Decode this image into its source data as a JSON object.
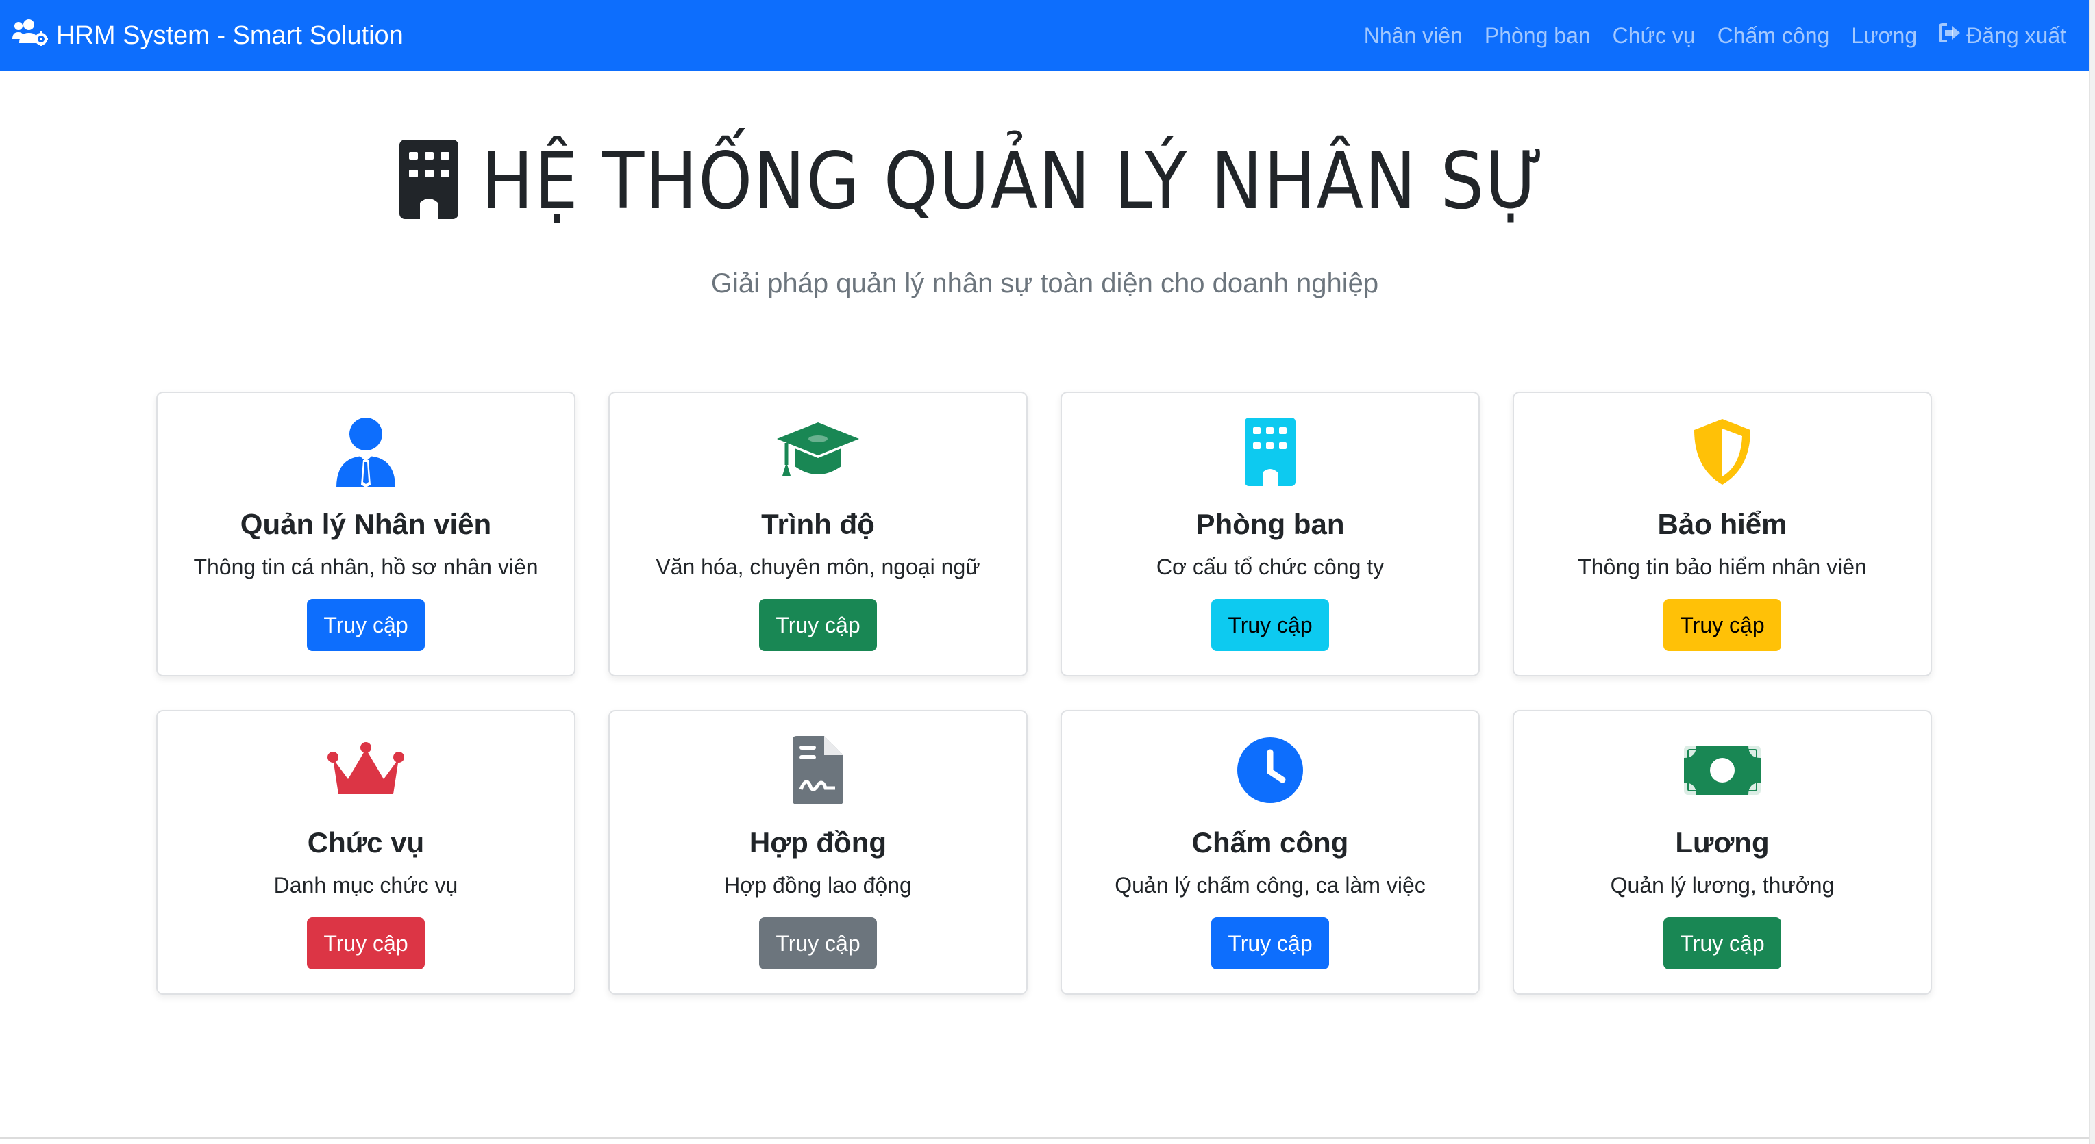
{
  "navbar": {
    "brand": "HRM System - Smart Solution",
    "links": [
      "Nhân viên",
      "Phòng ban",
      "Chức vụ",
      "Chấm công",
      "Lương"
    ],
    "logout": "Đăng xuất"
  },
  "hero": {
    "title": "HỆ THỐNG QUẢN LÝ NHÂN SỰ",
    "subtitle": "Giải pháp quản lý nhân sự toàn diện cho doanh nghiệp"
  },
  "cards": [
    {
      "title": "Quản lý Nhân viên",
      "desc": "Thông tin cá nhân, hồ sơ nhân viên",
      "button": "Truy cập",
      "icon": "user-tie-icon",
      "color": "#0d6efd"
    },
    {
      "title": "Trình độ",
      "desc": "Văn hóa, chuyên môn, ngoại ngữ",
      "button": "Truy cập",
      "icon": "graduation-cap-icon",
      "color": "#198754"
    },
    {
      "title": "Phòng ban",
      "desc": "Cơ cấu tổ chức công ty",
      "button": "Truy cập",
      "icon": "building-icon",
      "color": "#0dcaf0"
    },
    {
      "title": "Bảo hiểm",
      "desc": "Thông tin bảo hiểm nhân viên",
      "button": "Truy cập",
      "icon": "shield-icon",
      "color": "#ffc107"
    },
    {
      "title": "Chức vụ",
      "desc": "Danh mục chức vụ",
      "button": "Truy cập",
      "icon": "crown-icon",
      "color": "#dc3545"
    },
    {
      "title": "Hợp đồng",
      "desc": "Hợp đồng lao động",
      "button": "Truy cập",
      "icon": "file-contract-icon",
      "color": "#6c757d"
    },
    {
      "title": "Chấm công",
      "desc": "Quản lý chấm công, ca làm việc",
      "button": "Truy cập",
      "icon": "clock-icon",
      "color": "#0d6efd"
    },
    {
      "title": "Lương",
      "desc": "Quản lý lương, thưởng",
      "button": "Truy cập",
      "icon": "money-bill-icon",
      "color": "#198754"
    }
  ]
}
